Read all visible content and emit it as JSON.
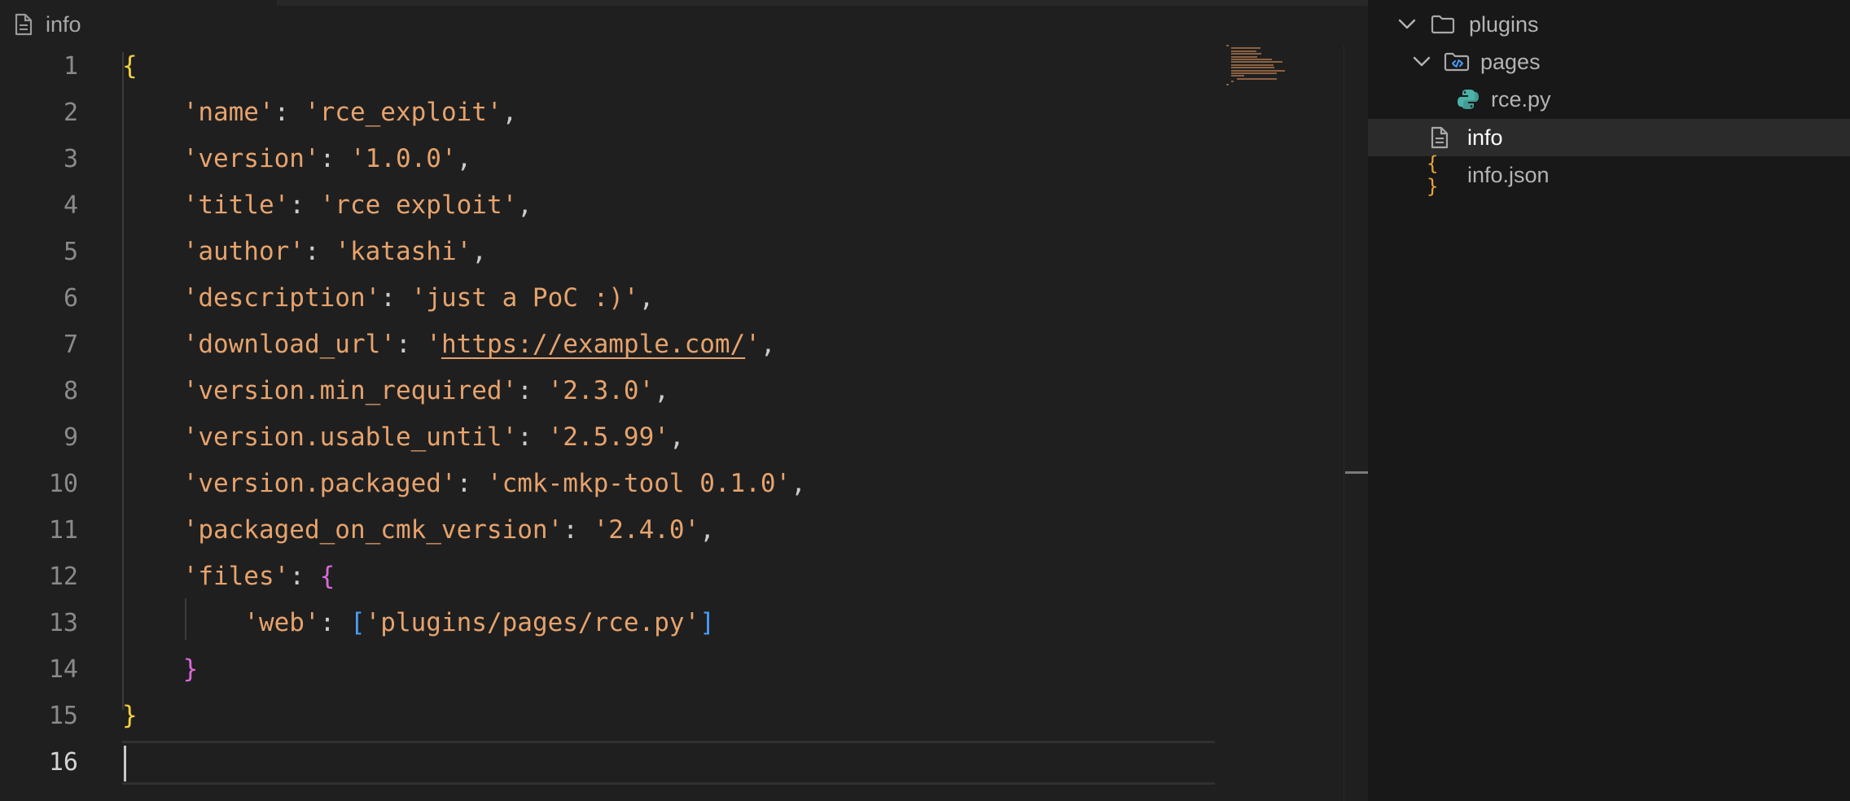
{
  "breadcrumb": {
    "file_name": "info",
    "icon": "file-icon"
  },
  "editor": {
    "active_line": 16,
    "lines": [
      {
        "num": "1",
        "tokens": [
          {
            "t": "{",
            "c": "tok-b1"
          }
        ]
      },
      {
        "num": "2",
        "tokens": [
          {
            "t": "    ",
            "c": ""
          },
          {
            "t": "'name'",
            "c": "tok-key"
          },
          {
            "t": ": ",
            "c": "tok-punc"
          },
          {
            "t": "'rce_exploit'",
            "c": "tok-str"
          },
          {
            "t": ",",
            "c": "tok-punc"
          }
        ]
      },
      {
        "num": "3",
        "tokens": [
          {
            "t": "    ",
            "c": ""
          },
          {
            "t": "'version'",
            "c": "tok-key"
          },
          {
            "t": ": ",
            "c": "tok-punc"
          },
          {
            "t": "'1.0.0'",
            "c": "tok-str"
          },
          {
            "t": ",",
            "c": "tok-punc"
          }
        ]
      },
      {
        "num": "4",
        "tokens": [
          {
            "t": "    ",
            "c": ""
          },
          {
            "t": "'title'",
            "c": "tok-key"
          },
          {
            "t": ": ",
            "c": "tok-punc"
          },
          {
            "t": "'rce exploit'",
            "c": "tok-str"
          },
          {
            "t": ",",
            "c": "tok-punc"
          }
        ]
      },
      {
        "num": "5",
        "tokens": [
          {
            "t": "    ",
            "c": ""
          },
          {
            "t": "'author'",
            "c": "tok-key"
          },
          {
            "t": ": ",
            "c": "tok-punc"
          },
          {
            "t": "'katashi'",
            "c": "tok-str"
          },
          {
            "t": ",",
            "c": "tok-punc"
          }
        ]
      },
      {
        "num": "6",
        "tokens": [
          {
            "t": "    ",
            "c": ""
          },
          {
            "t": "'description'",
            "c": "tok-key"
          },
          {
            "t": ": ",
            "c": "tok-punc"
          },
          {
            "t": "'just a PoC :)'",
            "c": "tok-str"
          },
          {
            "t": ",",
            "c": "tok-punc"
          }
        ]
      },
      {
        "num": "7",
        "tokens": [
          {
            "t": "    ",
            "c": ""
          },
          {
            "t": "'download_url'",
            "c": "tok-key"
          },
          {
            "t": ": ",
            "c": "tok-punc"
          },
          {
            "t": "'",
            "c": "tok-str"
          },
          {
            "t": "https://example.com/",
            "c": "tok-url"
          },
          {
            "t": "'",
            "c": "tok-str"
          },
          {
            "t": ",",
            "c": "tok-punc"
          }
        ]
      },
      {
        "num": "8",
        "tokens": [
          {
            "t": "    ",
            "c": ""
          },
          {
            "t": "'version.min_required'",
            "c": "tok-key"
          },
          {
            "t": ": ",
            "c": "tok-punc"
          },
          {
            "t": "'2.3.0'",
            "c": "tok-str"
          },
          {
            "t": ",",
            "c": "tok-punc"
          }
        ]
      },
      {
        "num": "9",
        "tokens": [
          {
            "t": "    ",
            "c": ""
          },
          {
            "t": "'version.usable_until'",
            "c": "tok-key"
          },
          {
            "t": ": ",
            "c": "tok-punc"
          },
          {
            "t": "'2.5.99'",
            "c": "tok-str"
          },
          {
            "t": ",",
            "c": "tok-punc"
          }
        ]
      },
      {
        "num": "10",
        "tokens": [
          {
            "t": "    ",
            "c": ""
          },
          {
            "t": "'version.packaged'",
            "c": "tok-key"
          },
          {
            "t": ": ",
            "c": "tok-punc"
          },
          {
            "t": "'cmk-mkp-tool 0.1.0'",
            "c": "tok-str"
          },
          {
            "t": ",",
            "c": "tok-punc"
          }
        ]
      },
      {
        "num": "11",
        "tokens": [
          {
            "t": "    ",
            "c": ""
          },
          {
            "t": "'packaged_on_cmk_version'",
            "c": "tok-key"
          },
          {
            "t": ": ",
            "c": "tok-punc"
          },
          {
            "t": "'2.4.0'",
            "c": "tok-str"
          },
          {
            "t": ",",
            "c": "tok-punc"
          }
        ]
      },
      {
        "num": "12",
        "tokens": [
          {
            "t": "    ",
            "c": ""
          },
          {
            "t": "'files'",
            "c": "tok-key"
          },
          {
            "t": ": ",
            "c": "tok-punc"
          },
          {
            "t": "{",
            "c": "tok-b2"
          }
        ]
      },
      {
        "num": "13",
        "tokens": [
          {
            "t": "        ",
            "c": ""
          },
          {
            "t": "'web'",
            "c": "tok-key"
          },
          {
            "t": ": ",
            "c": "tok-punc"
          },
          {
            "t": "[",
            "c": "tok-b3"
          },
          {
            "t": "'plugins/pages/rce.py'",
            "c": "tok-str"
          },
          {
            "t": "]",
            "c": "tok-b3"
          }
        ]
      },
      {
        "num": "14",
        "tokens": [
          {
            "t": "    ",
            "c": ""
          },
          {
            "t": "}",
            "c": "tok-b2"
          }
        ]
      },
      {
        "num": "15",
        "tokens": [
          {
            "t": "}",
            "c": "tok-b1"
          }
        ]
      },
      {
        "num": "16",
        "tokens": []
      }
    ]
  },
  "explorer": {
    "items": [
      {
        "label": "plugins",
        "icon": "folder-icon",
        "chevron": "chevron-down-icon",
        "selected": false
      },
      {
        "label": "pages",
        "icon": "code-folder-icon",
        "chevron": "chevron-down-icon",
        "selected": false
      },
      {
        "label": "rce.py",
        "icon": "python-icon",
        "chevron": "",
        "selected": false
      },
      {
        "label": "info",
        "icon": "file-icon",
        "chevron": "",
        "selected": true
      },
      {
        "label": "info.json",
        "icon": "json-braces-icon",
        "chevron": "",
        "selected": false
      }
    ]
  },
  "colors": {
    "editor_background": "#1f1f1f",
    "sidebar_background": "#181818",
    "string": "#e6a36d",
    "bracket_level1": "#f4d03f",
    "bracket_level2": "#d66ad6",
    "bracket_level3": "#4a9df8",
    "json_icon": "#e8a33d",
    "python_icon": "#4bb3a8"
  }
}
